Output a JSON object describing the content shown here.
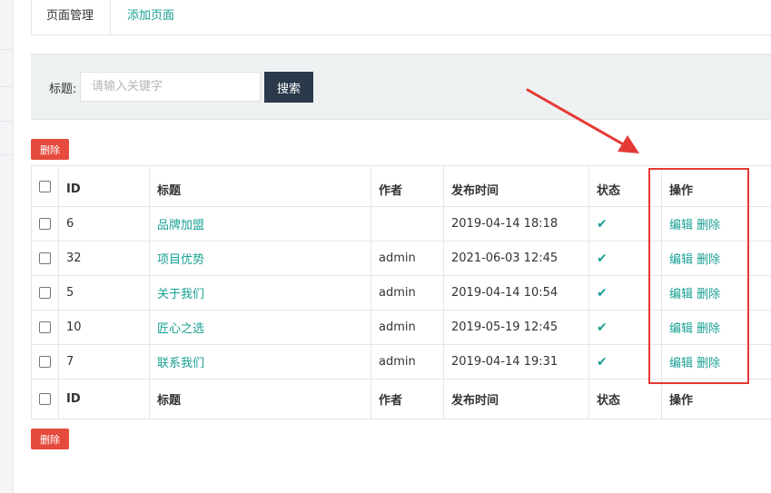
{
  "tabs": [
    {
      "label": "页面管理",
      "active": true
    },
    {
      "label": "添加页面",
      "active": false
    }
  ],
  "search": {
    "label": "标题:",
    "placeholder": "请输入关键字",
    "value": "",
    "button_label": "搜索"
  },
  "actions": {
    "delete_label": "删除"
  },
  "table": {
    "columns": [
      "ID",
      "标题",
      "作者",
      "发布时间",
      "状态",
      "操作"
    ],
    "rows": [
      {
        "id": "6",
        "title": "品牌加盟",
        "author": "",
        "time": "2019-04-14 18:18",
        "status": "✔",
        "edit": "编辑",
        "delete": "删除"
      },
      {
        "id": "32",
        "title": "项目优势",
        "author": "admin",
        "time": "2021-06-03 12:45",
        "status": "✔",
        "edit": "编辑",
        "delete": "删除"
      },
      {
        "id": "5",
        "title": "关于我们",
        "author": "admin",
        "time": "2019-04-14 10:54",
        "status": "✔",
        "edit": "编辑",
        "delete": "删除"
      },
      {
        "id": "10",
        "title": "匠心之选",
        "author": "admin",
        "time": "2019-05-19 12:45",
        "status": "✔",
        "edit": "编辑",
        "delete": "删除"
      },
      {
        "id": "7",
        "title": "联系我们",
        "author": "admin",
        "time": "2019-04-14 19:31",
        "status": "✔",
        "edit": "编辑",
        "delete": "删除"
      }
    ]
  },
  "colors": {
    "accent": "#1aa094",
    "danger": "#e54b3d",
    "search_button": "#2a3a4b",
    "annotation": "#e53935"
  },
  "icons": {
    "status": "check-icon"
  }
}
